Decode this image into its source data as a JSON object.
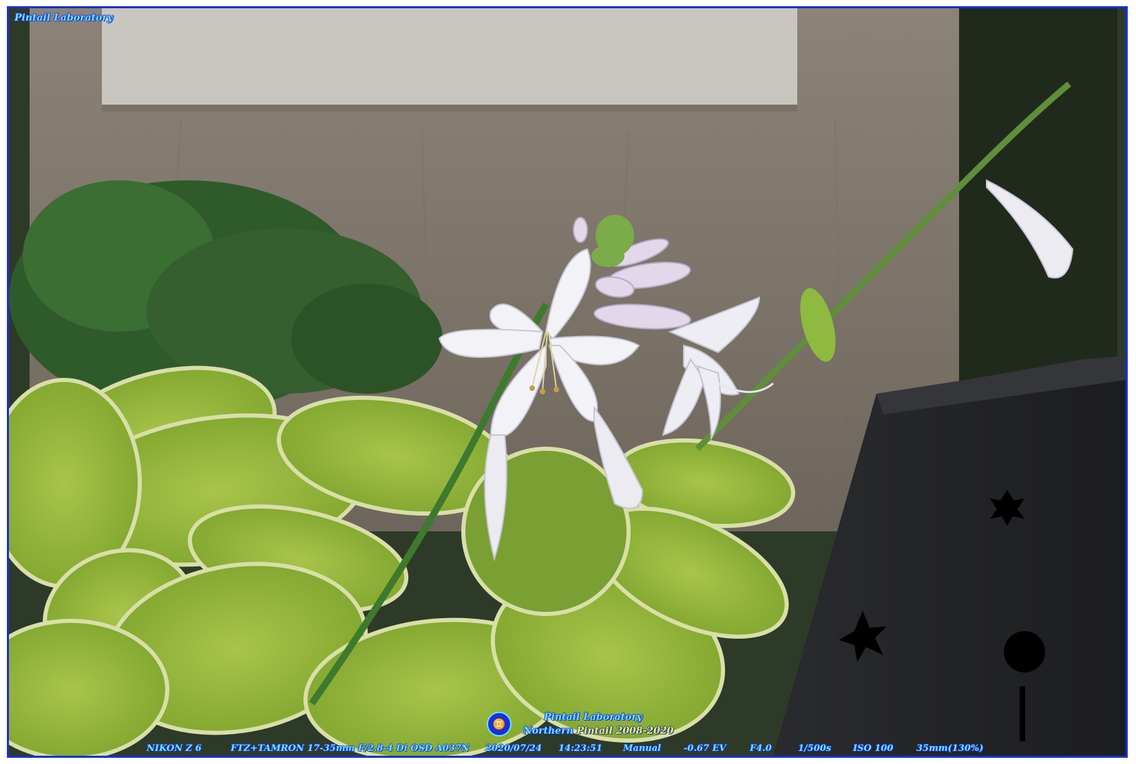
{
  "watermark_top": "Pintail Laboratory",
  "credit": {
    "logo_glyph": "♊",
    "line1": "Pintail Laboratory",
    "line2_prefix": "Northern",
    "line2_highlight": "Pintail 2008-2020"
  },
  "exif": {
    "camera": "NIKON Z 6",
    "lens": "FTZ+TAMRON 17-35mm F/2.8-4 Di OSD A037N",
    "date": "2020/07/24",
    "time": "14:23:51",
    "mode": "Manual",
    "ev": "-0.67 EV",
    "aperture": "F4.0",
    "shutter": "1/500s",
    "iso": "ISO 100",
    "focal": "35mm(130%)"
  },
  "colors": {
    "frame_border": "#1a2fd6",
    "watermark_text": "#66e6ff",
    "highlight": "#ffff33"
  }
}
